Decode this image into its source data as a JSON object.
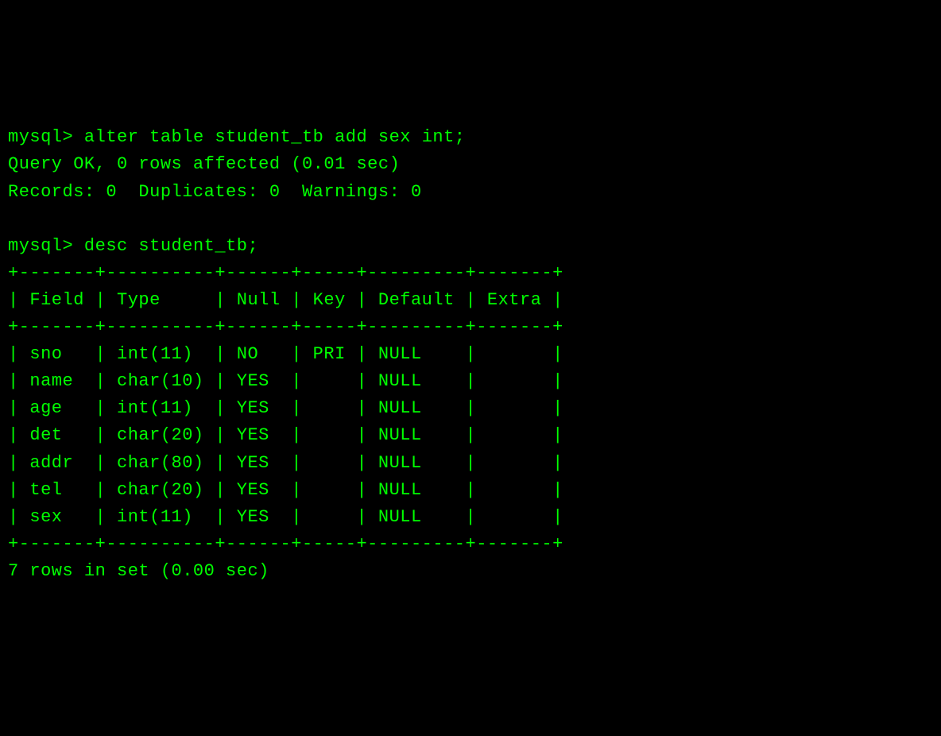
{
  "prompt1": "mysql> ",
  "command1": "alter table student_tb add sex int;",
  "result1_line1": "Query OK, 0 rows affected (0.01 sec)",
  "result1_line2": "Records: 0  Duplicates: 0  Warnings: 0",
  "prompt2": "mysql> ",
  "command2": "desc student_tb;",
  "table": {
    "border": "+-------+----------+------+-----+---------+-------+",
    "header": "| Field | Type     | Null | Key | Default | Extra |",
    "rows": [
      "| sno   | int(11)  | NO   | PRI | NULL    |       |",
      "| name  | char(10) | YES  |     | NULL    |       |",
      "| age   | int(11)  | YES  |     | NULL    |       |",
      "| det   | char(20) | YES  |     | NULL    |       |",
      "| addr  | char(80) | YES  |     | NULL    |       |",
      "| tel   | char(20) | YES  |     | NULL    |       |",
      "| sex   | int(11)  | YES  |     | NULL    |       |"
    ]
  },
  "footer": "7 rows in set (0.00 sec)",
  "chart_data": {
    "type": "table",
    "title": "desc student_tb",
    "columns": [
      "Field",
      "Type",
      "Null",
      "Key",
      "Default",
      "Extra"
    ],
    "rows": [
      [
        "sno",
        "int(11)",
        "NO",
        "PRI",
        "NULL",
        ""
      ],
      [
        "name",
        "char(10)",
        "YES",
        "",
        "NULL",
        ""
      ],
      [
        "age",
        "int(11)",
        "YES",
        "",
        "NULL",
        ""
      ],
      [
        "det",
        "char(20)",
        "YES",
        "",
        "NULL",
        ""
      ],
      [
        "addr",
        "char(80)",
        "YES",
        "",
        "NULL",
        ""
      ],
      [
        "tel",
        "char(20)",
        "YES",
        "",
        "NULL",
        ""
      ],
      [
        "sex",
        "int(11)",
        "YES",
        "",
        "NULL",
        ""
      ]
    ]
  }
}
